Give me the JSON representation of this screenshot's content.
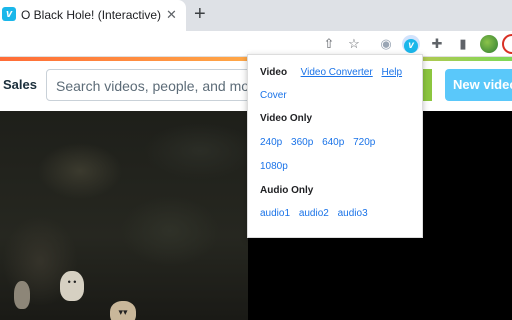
{
  "browser": {
    "tab": {
      "favicon_glyph": "v",
      "title": "O Black Hole! (Interactive) on Vimeo",
      "close_glyph": "✕"
    },
    "new_tab_glyph": "+",
    "toolbar_icons": [
      {
        "name": "share-icon",
        "glyph": "⇧"
      },
      {
        "name": "bookmark-star-icon",
        "glyph": "☆"
      },
      {
        "name": "extension-owl-icon",
        "glyph": "◉"
      },
      {
        "name": "vimeo-extension-icon",
        "glyph": "v"
      },
      {
        "name": "extensions-puzzle-icon",
        "glyph": "✚"
      },
      {
        "name": "side-panel-icon",
        "glyph": "▮"
      }
    ],
    "accent_color": "#1ab7ea"
  },
  "site": {
    "sales_label": "Sales",
    "search_placeholder": "Search videos, people, and more",
    "new_video_label": "New video"
  },
  "popup": {
    "video_heading": "Video",
    "video_links": [
      "Video Converter",
      "Help"
    ],
    "cover_link": "Cover",
    "video_only_heading": "Video Only",
    "video_only_links": [
      "240p",
      "360p",
      "640p",
      "720p"
    ],
    "video_only_more": [
      "1080p"
    ],
    "audio_only_heading": "Audio Only",
    "audio_links": [
      "audio1",
      "audio2",
      "audio3"
    ]
  }
}
